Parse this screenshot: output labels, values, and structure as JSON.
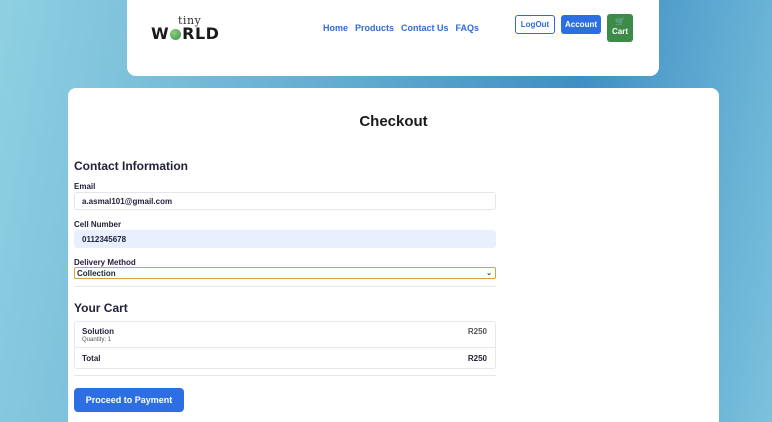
{
  "nav": {
    "logo_top": "tiny",
    "logo_left": "W",
    "logo_right": "RLD",
    "links": [
      "Home",
      "Products",
      "Contact Us",
      "FAQs"
    ],
    "logout": "LogOut",
    "account": "Account",
    "cart": "Cart"
  },
  "page": {
    "title": "Checkout"
  },
  "contact": {
    "title": "Contact Information",
    "email_label": "Email",
    "email_value": "a.asmal101@gmail.com",
    "cell_label": "Cell Number",
    "cell_value": "0112345678",
    "delivery_label": "Delivery Method",
    "delivery_value": "Collection"
  },
  "cart": {
    "title": "Your Cart",
    "items": [
      {
        "name": "Solution",
        "quantity": "Quantity: 1",
        "price": "R250"
      }
    ],
    "total_label": "Total",
    "total_value": "R250"
  },
  "actions": {
    "pay": "Proceed to Payment"
  },
  "colors": {
    "primary": "#2d6ee3",
    "cart_green": "#3d8b48",
    "select_border": "#d6a23a"
  },
  "icons": {
    "cart": "shopping-cart-icon",
    "chevron": "chevron-down-icon",
    "globe": "globe-icon"
  }
}
